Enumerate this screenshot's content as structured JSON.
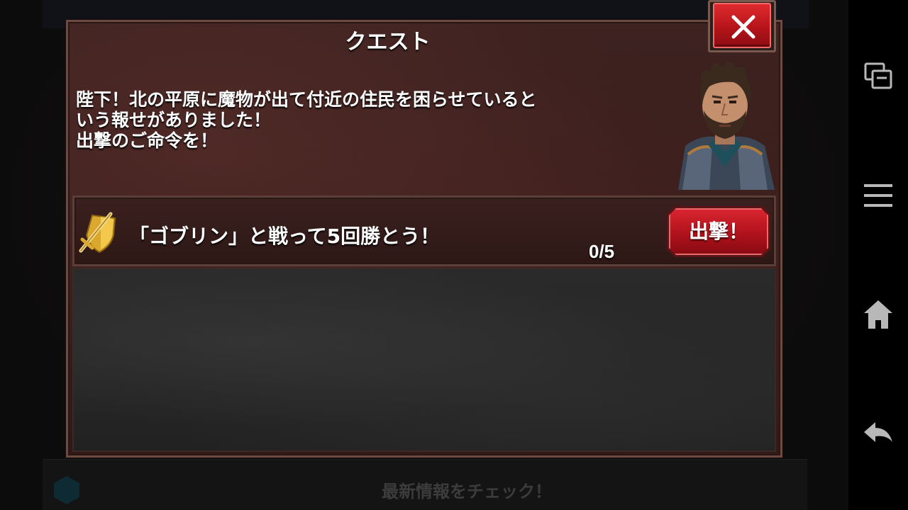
{
  "dialog": {
    "title": "クエスト",
    "message_lines": [
      "陛下！北の平原に魔物が出て付近の住民を困らせていると",
      "いう報せがありました！",
      "出撃のご命令を！"
    ],
    "close_icon": "close-icon",
    "portrait": "knight-portrait"
  },
  "mission": {
    "icon": "sword-shield-icon",
    "text": "「ゴブリン」と戦って5回勝とう！",
    "progress": "0/5",
    "progress_value": 0,
    "progress_max": 5,
    "sortie_label": "出撃！"
  },
  "background": {
    "news_text": "最新情報をチェック！",
    "news_icon": "hexagon-icon"
  },
  "navbar": {
    "items": [
      "recent-apps-icon",
      "menu-icon",
      "home-icon",
      "back-icon"
    ]
  },
  "colors": {
    "close_red": "#c8181e",
    "sortie_red": "#b0121c",
    "dialog_brown": "#3d2220",
    "text_white": "#ffffff"
  }
}
